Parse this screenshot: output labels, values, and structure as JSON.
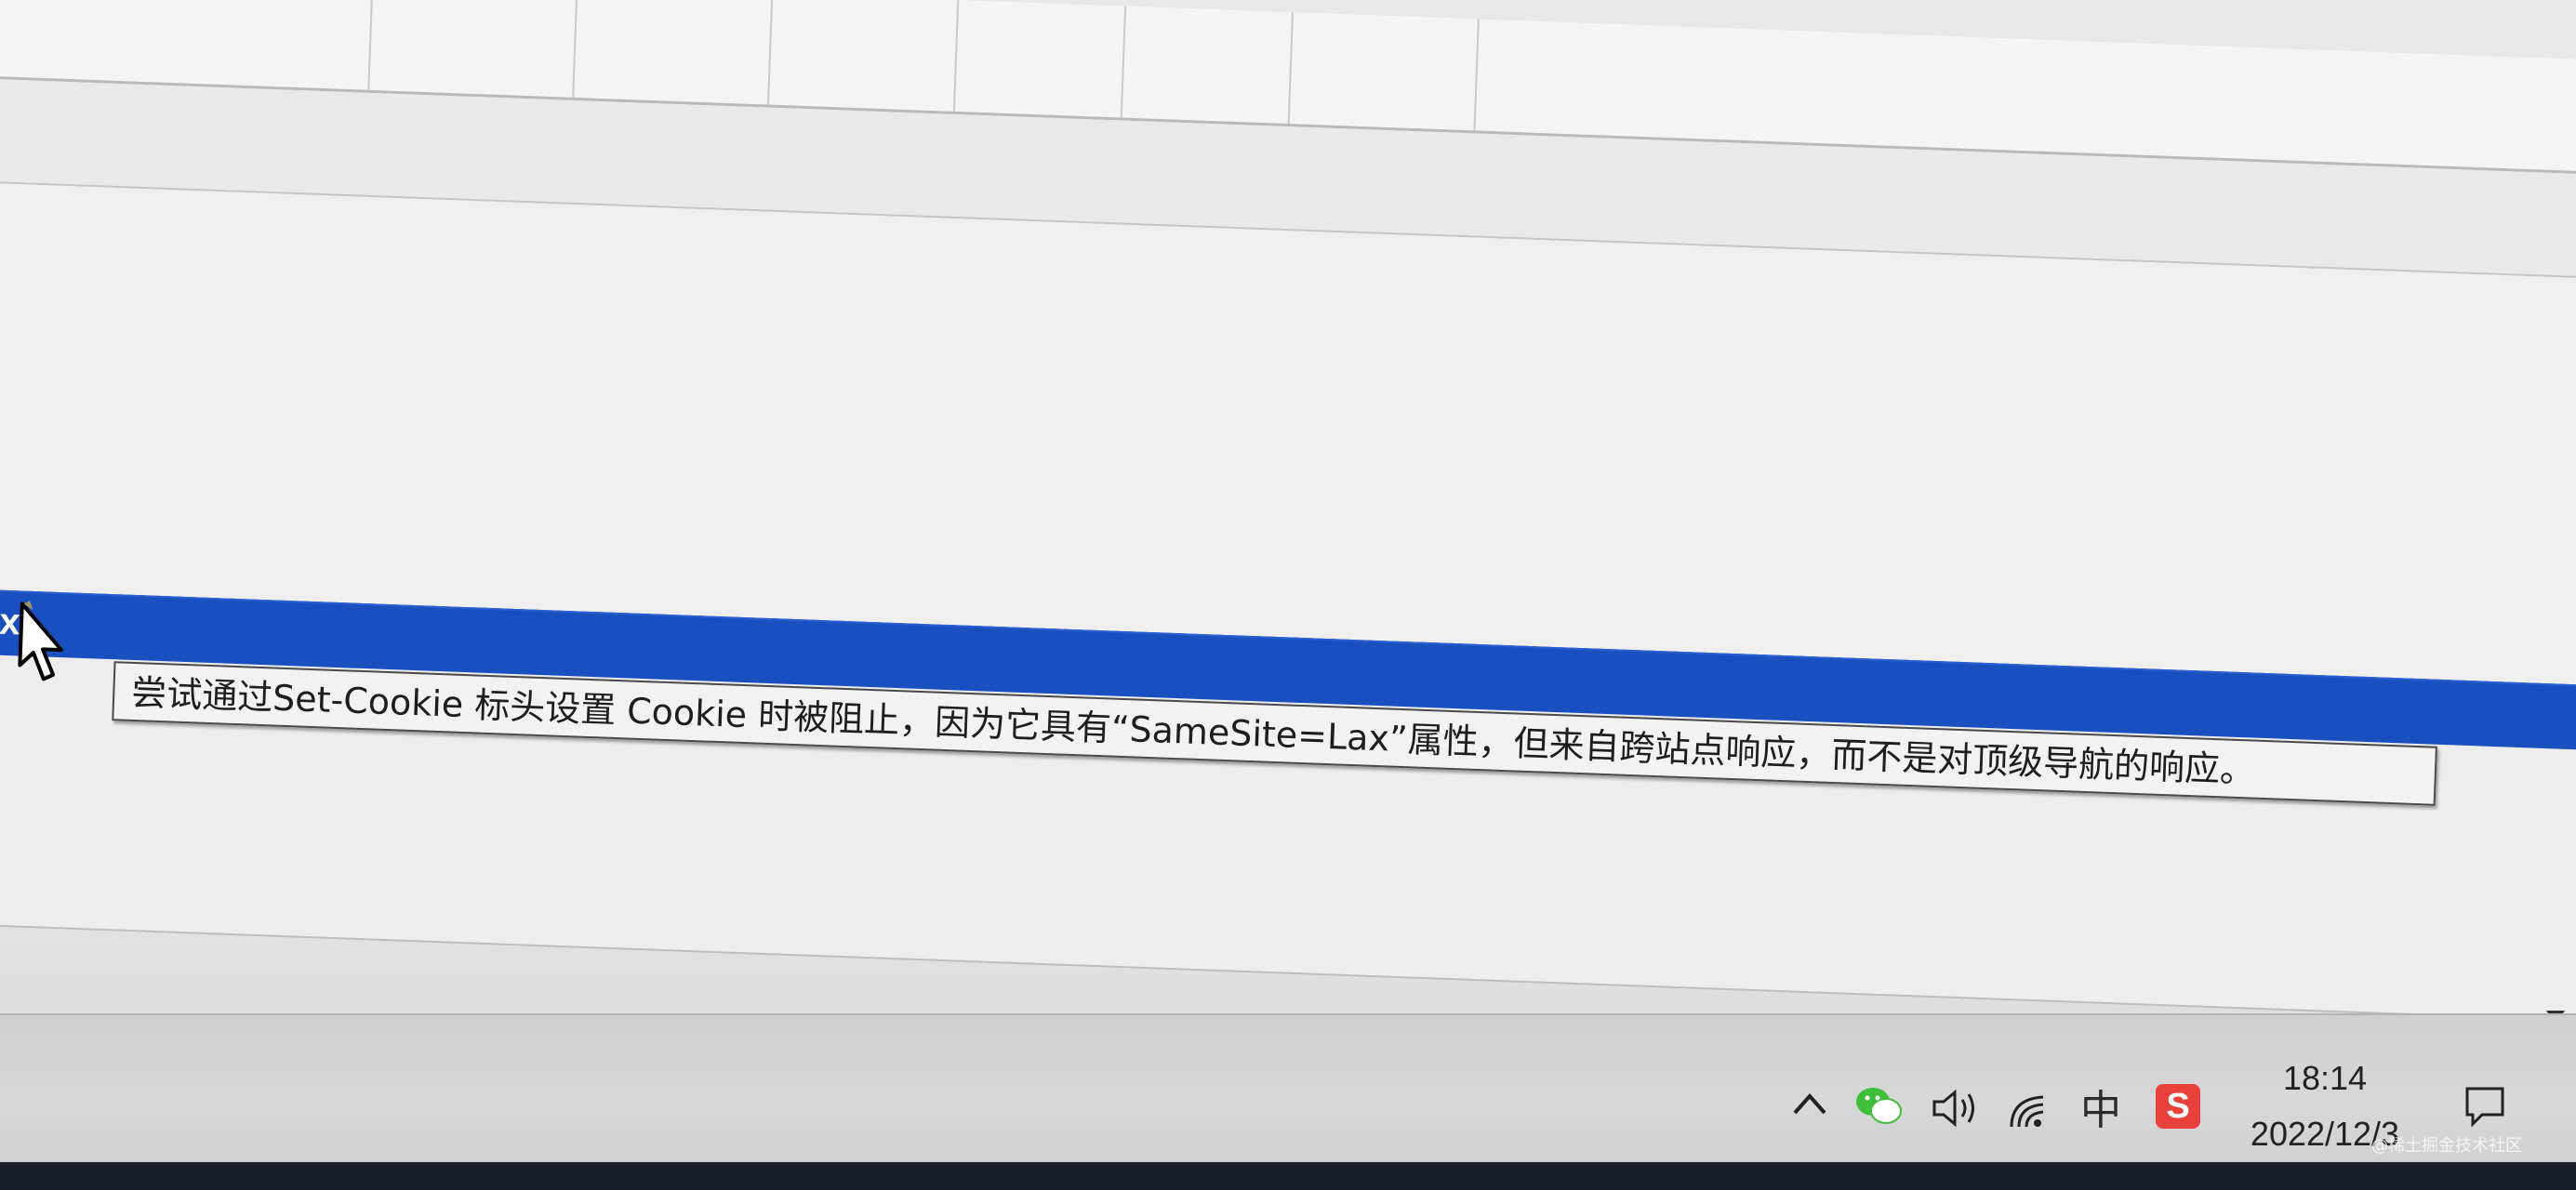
{
  "devtools": {
    "selected_row_text": "ax",
    "tooltip_text": "尝试通过Set-Cookie 标头设置 Cookie 时被阻止，因为它具有“SameSite=Lax”属性，但来自跨站点响应，而不是对顶级导航的响应。"
  },
  "taskbar": {
    "tray": {
      "chevron_icon": "chevron-up-icon",
      "wechat_icon": "wechat-icon",
      "volume_icon": "volume-icon",
      "network_icon": "wifi-icon",
      "ime_label": "中",
      "sogou_label": "S"
    },
    "clock": {
      "time": "18:14",
      "date": "2022/12/3"
    },
    "notification_icon": "notification-icon"
  },
  "watermark": "@稀土掘金技术社区",
  "colors": {
    "selection_blue": "#1a4fbf",
    "tooltip_bg": "#f2f2f2",
    "sogou_red": "#e8403a",
    "wechat_green": "#3fbe3a"
  }
}
